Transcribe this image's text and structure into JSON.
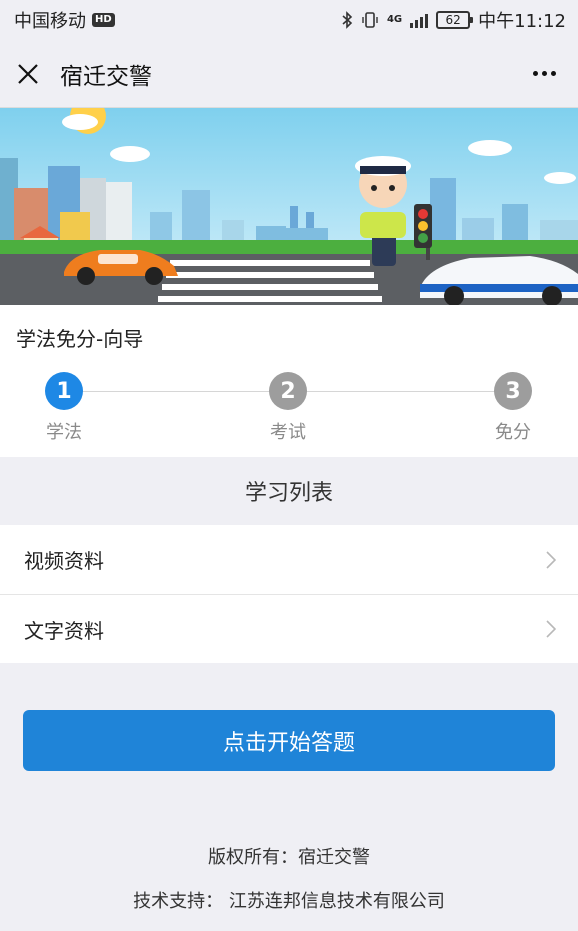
{
  "status_bar": {
    "carrier": "中国移动",
    "hd_badge": "HD",
    "network": "4G",
    "battery": "62",
    "time": "中午11:12"
  },
  "nav": {
    "title": "宿迁交警",
    "close_icon": "close-icon",
    "more_icon": "more-icon"
  },
  "guide": {
    "title": "学法免分-向导",
    "current_step": 1,
    "steps": [
      {
        "number": "1",
        "label": "学法"
      },
      {
        "number": "2",
        "label": "考试"
      },
      {
        "number": "3",
        "label": "免分"
      }
    ]
  },
  "study": {
    "header": "学习列表",
    "items": [
      {
        "label": "视频资料"
      },
      {
        "label": "文字资料"
      }
    ]
  },
  "start_button": "点击开始答题",
  "footer": {
    "copyright": "版权所有：宿迁交警",
    "support": "技术支持：  江苏连邦信息技术有限公司"
  },
  "colors": {
    "accent": "#1e88e5",
    "button": "#1f84d8",
    "inactive_step": "#9d9d9d",
    "page_bg": "#efeff4"
  }
}
